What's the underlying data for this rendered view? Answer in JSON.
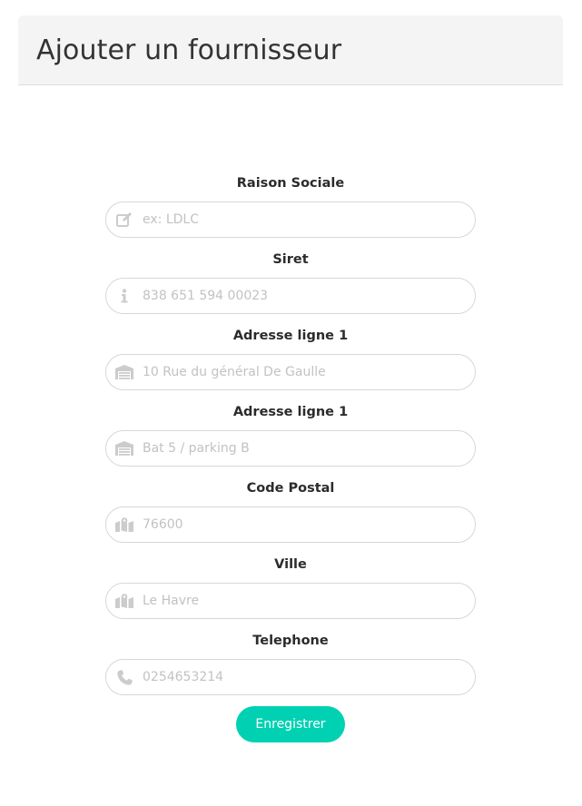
{
  "page": {
    "title": "Ajouter un fournisseur"
  },
  "colors": {
    "accent": "#00d1b2",
    "header_bg": "#f4f4f4",
    "icon": "#cccccc",
    "placeholder": "#c2c2c2"
  },
  "form": {
    "fields": [
      {
        "label": "Raison Sociale",
        "placeholder": "ex: LDLC",
        "icon": "edit-icon"
      },
      {
        "label": "Siret",
        "placeholder": "838 651 594 00023",
        "icon": "info-icon"
      },
      {
        "label": "Adresse ligne 1",
        "placeholder": "10 Rue du général De Gaulle",
        "icon": "warehouse-icon"
      },
      {
        "label": "Adresse ligne 1",
        "placeholder": "Bat 5 / parking B",
        "icon": "warehouse-icon"
      },
      {
        "label": "Code Postal",
        "placeholder": "76600",
        "icon": "map-icon"
      },
      {
        "label": "Ville",
        "placeholder": "Le Havre",
        "icon": "map-icon"
      },
      {
        "label": "Telephone",
        "placeholder": "0254653214",
        "icon": "phone-icon"
      }
    ],
    "submit_label": "Enregistrer"
  }
}
